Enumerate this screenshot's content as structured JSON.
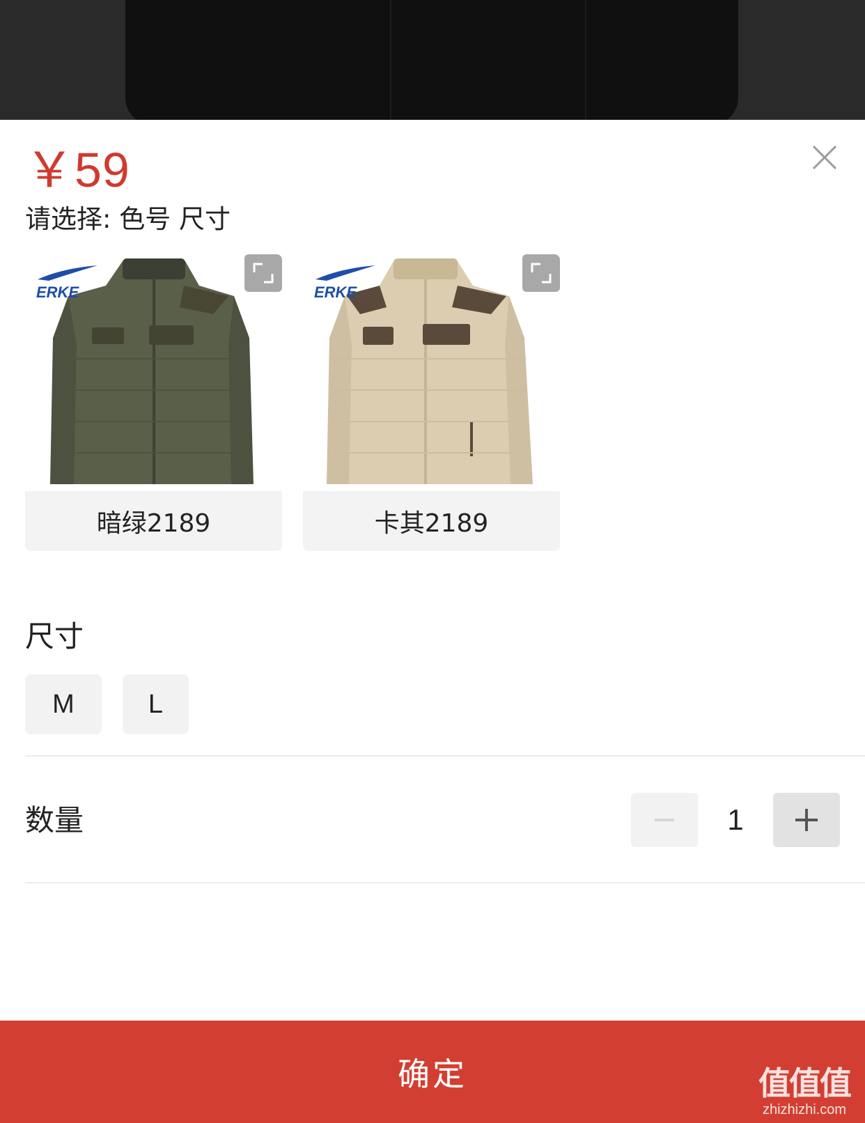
{
  "product": {
    "price": "￥59",
    "select_hint": "请选择: 色号 尺寸",
    "brand_logo_text": "ERKE"
  },
  "variants": [
    {
      "label": "暗绿2189",
      "color": "#5a5f4a"
    },
    {
      "label": "卡其2189",
      "color": "#dccdb1"
    }
  ],
  "size_section": {
    "title": "尺寸",
    "options": [
      "M",
      "L"
    ]
  },
  "quantity": {
    "label": "数量",
    "value": "1"
  },
  "confirm": {
    "label": "确定"
  },
  "watermark": {
    "text": "值值值",
    "url": "zhizhizhi.com"
  },
  "colors": {
    "accent": "#d23f32",
    "price": "#d03a2e"
  }
}
